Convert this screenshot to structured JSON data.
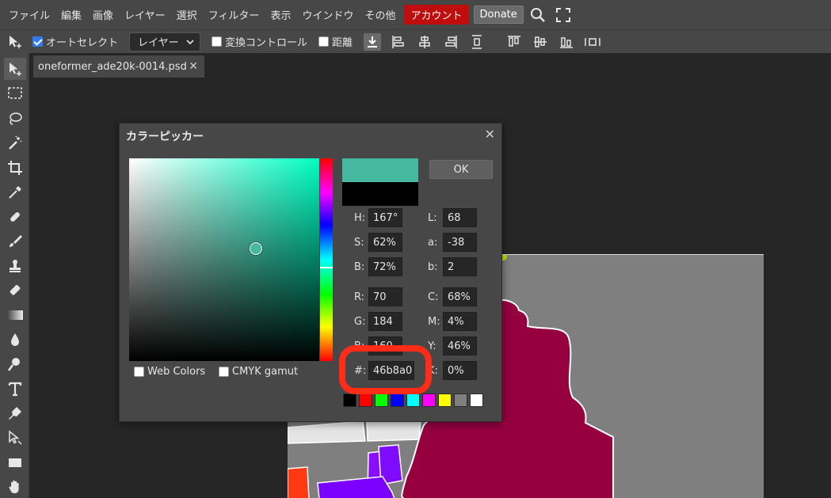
{
  "menu": {
    "items": [
      "ファイル",
      "編集",
      "画像",
      "レイヤー",
      "選択",
      "フィルター",
      "表示",
      "ウインドウ",
      "その他"
    ],
    "account": "アカウント",
    "donate": "Donate"
  },
  "options": {
    "auto_select": "オートセレクト",
    "layer_select": "レイヤー",
    "transform_controls": "変換コントロール",
    "distance": "距離"
  },
  "document": {
    "tab_name": "oneformer_ade20k-0014.psd"
  },
  "picker": {
    "title": "カラーピッカー",
    "ok": "OK",
    "new_color": "#46b8a0",
    "old_color": "#000000",
    "fields": {
      "H": {
        "label": "H:",
        "value": "167°"
      },
      "S": {
        "label": "S:",
        "value": "62%"
      },
      "B": {
        "label": "B:",
        "value": "72%"
      },
      "R": {
        "label": "R:",
        "value": "70"
      },
      "G": {
        "label": "G:",
        "value": "184"
      },
      "Bl": {
        "label": "B:",
        "value": "160"
      },
      "hex": {
        "label": "#:",
        "value": "46b8a0"
      },
      "L": {
        "label": "L:",
        "value": "68"
      },
      "a": {
        "label": "a:",
        "value": "-38"
      },
      "b": {
        "label": "b:",
        "value": "2"
      },
      "C": {
        "label": "C:",
        "value": "68%"
      },
      "M": {
        "label": "M:",
        "value": "4%"
      },
      "Y": {
        "label": "Y:",
        "value": "46%"
      },
      "K": {
        "label": "K:",
        "value": "0%"
      }
    },
    "web_colors": "Web Colors",
    "cmyk_gamut": "CMYK gamut",
    "palette": [
      "#000000",
      "#ff0000",
      "#00ff00",
      "#0000ff",
      "#00ffff",
      "#ff00ff",
      "#ffff00",
      "#808080",
      "#ffffff"
    ]
  }
}
